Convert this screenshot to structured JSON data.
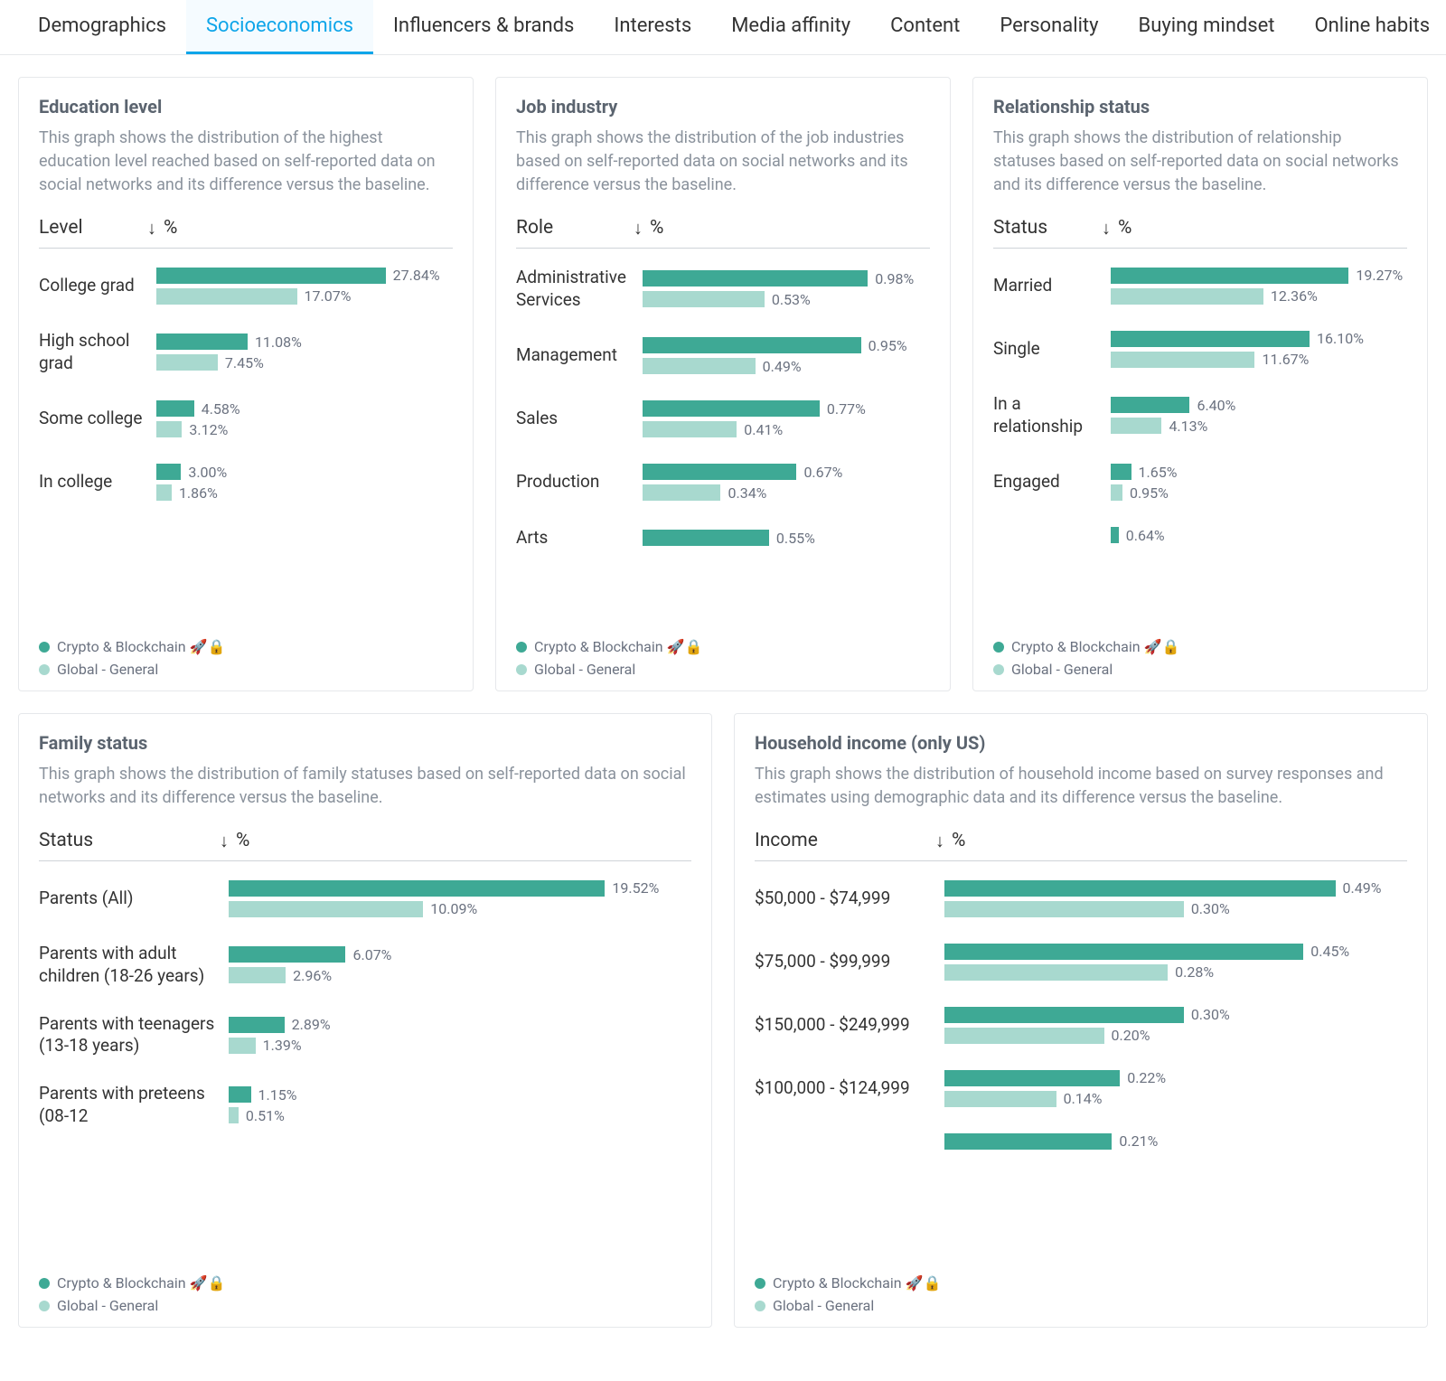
{
  "tabs": [
    {
      "label": "Demographics",
      "active": false
    },
    {
      "label": "Socioeconomics",
      "active": true
    },
    {
      "label": "Influencers & brands",
      "active": false
    },
    {
      "label": "Interests",
      "active": false
    },
    {
      "label": "Media affinity",
      "active": false
    },
    {
      "label": "Content",
      "active": false
    },
    {
      "label": "Personality",
      "active": false
    },
    {
      "label": "Buying mindset",
      "active": false
    },
    {
      "label": "Online habits",
      "active": false
    }
  ],
  "legend": {
    "primary": "Crypto & Blockchain 🚀🔒",
    "secondary": "Global - General"
  },
  "sort_symbol": "↓",
  "percent_symbol": "%",
  "colors": {
    "primary": "#3ea995",
    "secondary": "#a8d9cf",
    "accent": "#0ea5e9"
  },
  "cards": {
    "education": {
      "title": "Education level",
      "desc": "This graph shows the distribution of the highest education level reached based on self-reported data on social networks and its difference versus the baseline.",
      "col_label": "Level",
      "rows": [
        {
          "label": "College grad",
          "primary": 27.84,
          "secondary": 17.07
        },
        {
          "label": "High school grad",
          "primary": 11.08,
          "secondary": 7.45
        },
        {
          "label": "Some college",
          "primary": 4.58,
          "secondary": 3.12
        },
        {
          "label": "In college",
          "primary": 3.0,
          "secondary": 1.86
        }
      ]
    },
    "job": {
      "title": "Job industry",
      "desc": "This graph shows the distribution of the job industries based on self-reported data on social networks and its difference versus the baseline.",
      "col_label": "Role",
      "rows": [
        {
          "label": "Administrative Services",
          "primary": 0.98,
          "secondary": 0.53
        },
        {
          "label": "Management",
          "primary": 0.95,
          "secondary": 0.49
        },
        {
          "label": "Sales",
          "primary": 0.77,
          "secondary": 0.41
        },
        {
          "label": "Production",
          "primary": 0.67,
          "secondary": 0.34
        },
        {
          "label": "Arts",
          "primary": 0.55,
          "secondary": null
        }
      ]
    },
    "relationship": {
      "title": "Relationship status",
      "desc": "This graph shows the distribution of relationship statuses based on self-reported data on social networks and its difference versus the baseline.",
      "col_label": "Status",
      "rows": [
        {
          "label": "Married",
          "primary": 19.27,
          "secondary": 12.36
        },
        {
          "label": "Single",
          "primary": 16.1,
          "secondary": 11.67
        },
        {
          "label": "In a relationship",
          "primary": 6.4,
          "secondary": 4.13
        },
        {
          "label": "Engaged",
          "primary": 1.65,
          "secondary": 0.95
        },
        {
          "label": "",
          "primary": 0.64,
          "secondary": null
        }
      ]
    },
    "family": {
      "title": "Family status",
      "desc": "This graph shows the distribution of family statuses based on self-reported data on social networks and its difference versus the baseline.",
      "col_label": "Status",
      "rows": [
        {
          "label": "Parents (All)",
          "primary": 19.52,
          "secondary": 10.09
        },
        {
          "label": "Parents with adult children (18-26 years)",
          "primary": 6.07,
          "secondary": 2.96
        },
        {
          "label": "Parents with teenagers (13-18 years)",
          "primary": 2.89,
          "secondary": 1.39
        },
        {
          "label": "Parents with preteens (08-12",
          "primary": 1.15,
          "secondary": 0.51
        }
      ]
    },
    "income": {
      "title": "Household income (only US)",
      "desc": "This graph shows the distribution of household income based on survey responses and estimates using demographic data and its difference versus the baseline.",
      "col_label": "Income",
      "rows": [
        {
          "label": "$50,000 - $74,999",
          "primary": 0.49,
          "secondary": 0.3
        },
        {
          "label": "$75,000 - $99,999",
          "primary": 0.45,
          "secondary": 0.28
        },
        {
          "label": "$150,000 - $249,999",
          "primary": 0.3,
          "secondary": 0.2
        },
        {
          "label": "$100,000 - $124,999",
          "primary": 0.22,
          "secondary": 0.14
        },
        {
          "label": "",
          "primary": 0.21,
          "secondary": null
        }
      ]
    }
  },
  "chart_data": [
    {
      "type": "bar",
      "title": "Education level",
      "xlabel": "%",
      "ylabel": "Level",
      "categories": [
        "College grad",
        "High school grad",
        "Some college",
        "In college"
      ],
      "series": [
        {
          "name": "Crypto & Blockchain",
          "values": [
            27.84,
            11.08,
            4.58,
            3.0
          ]
        },
        {
          "name": "Global - General",
          "values": [
            17.07,
            7.45,
            3.12,
            1.86
          ]
        }
      ]
    },
    {
      "type": "bar",
      "title": "Job industry",
      "xlabel": "%",
      "ylabel": "Role",
      "categories": [
        "Administrative Services",
        "Management",
        "Sales",
        "Production",
        "Arts"
      ],
      "series": [
        {
          "name": "Crypto & Blockchain",
          "values": [
            0.98,
            0.95,
            0.77,
            0.67,
            0.55
          ]
        },
        {
          "name": "Global - General",
          "values": [
            0.53,
            0.49,
            0.41,
            0.34,
            null
          ]
        }
      ]
    },
    {
      "type": "bar",
      "title": "Relationship status",
      "xlabel": "%",
      "ylabel": "Status",
      "categories": [
        "Married",
        "Single",
        "In a relationship",
        "Engaged",
        ""
      ],
      "series": [
        {
          "name": "Crypto & Blockchain",
          "values": [
            19.27,
            16.1,
            6.4,
            1.65,
            0.64
          ]
        },
        {
          "name": "Global - General",
          "values": [
            12.36,
            11.67,
            4.13,
            0.95,
            null
          ]
        }
      ]
    },
    {
      "type": "bar",
      "title": "Family status",
      "xlabel": "%",
      "ylabel": "Status",
      "categories": [
        "Parents (All)",
        "Parents with adult children (18-26 years)",
        "Parents with teenagers (13-18 years)",
        "Parents with preteens (08-12"
      ],
      "series": [
        {
          "name": "Crypto & Blockchain",
          "values": [
            19.52,
            6.07,
            2.89,
            1.15
          ]
        },
        {
          "name": "Global - General",
          "values": [
            10.09,
            2.96,
            1.39,
            0.51
          ]
        }
      ]
    },
    {
      "type": "bar",
      "title": "Household income (only US)",
      "xlabel": "%",
      "ylabel": "Income",
      "categories": [
        "$50,000 - $74,999",
        "$75,000 - $99,999",
        "$150,000 - $249,999",
        "$100,000 - $124,999",
        ""
      ],
      "series": [
        {
          "name": "Crypto & Blockchain",
          "values": [
            0.49,
            0.45,
            0.3,
            0.22,
            0.21
          ]
        },
        {
          "name": "Global - General",
          "values": [
            0.3,
            0.28,
            0.2,
            0.14,
            null
          ]
        }
      ]
    }
  ]
}
